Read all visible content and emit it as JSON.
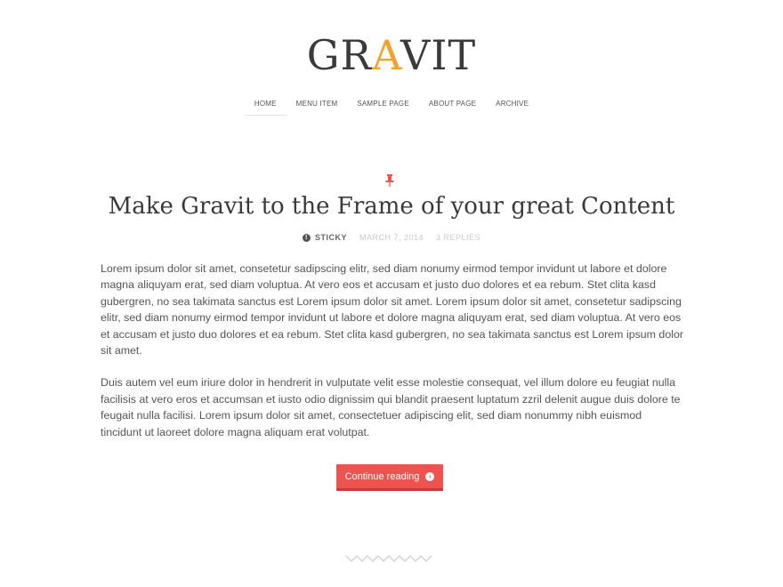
{
  "header": {
    "logo_part1": "GR",
    "logo_accent": "A",
    "logo_part2": "VIT",
    "accent_color": "#f3a32b"
  },
  "nav": {
    "items": [
      {
        "label": "HOME",
        "active": true
      },
      {
        "label": "MENU ITEM",
        "active": false
      },
      {
        "label": "SAMPLE PAGE",
        "active": false
      },
      {
        "label": "ABOUT PAGE",
        "active": false
      },
      {
        "label": "ARCHIVE",
        "active": false
      }
    ]
  },
  "post": {
    "pin_icon": "pushpin-icon",
    "pin_color": "#ef5350",
    "title": "Make Gravit to the Frame of your great Content",
    "meta": {
      "sticky_icon": "info-icon",
      "sticky_label": "STICKY",
      "date": "MARCH 7, 2014",
      "replies": "3 REPLIES"
    },
    "paragraphs": [
      "Lorem ipsum dolor sit amet, consetetur sadipscing elitr, sed diam nonumy eirmod tempor invidunt ut labore et dolore magna aliquyam erat, sed diam voluptua. At vero eos et accusam et justo duo dolores et ea rebum. Stet clita kasd gubergren, no sea takimata sanctus est Lorem ipsum dolor sit amet. Lorem ipsum dolor sit amet, consetetur sadipscing elitr, sed diam nonumy eirmod tempor invidunt ut labore et dolore magna aliquyam erat, sed diam voluptua. At vero eos et accusam et justo duo dolores et ea rebum. Stet clita kasd gubergren, no sea takimata sanctus est Lorem ipsum dolor sit amet.",
      "Duis autem vel eum iriure dolor in hendrerit in vulputate velit esse molestie consequat, vel illum dolore eu feugiat nulla facilisis at vero eros et accumsan et iusto odio dignissim qui blandit praesent luptatum zzril delenit augue duis dolore te feugait nulla facilisi. Lorem ipsum dolor sit amet, consectetuer adipiscing elit, sed diam nonummy nibh euismod tincidunt ut laoreet dolore magna aliquam erat volutpat."
    ],
    "continue_label": "Continue reading",
    "continue_icon": "chevron-right-circle-icon",
    "button_color": "#ef5350"
  },
  "footer": {
    "divider_icon": "zigzag-divider-icon"
  }
}
